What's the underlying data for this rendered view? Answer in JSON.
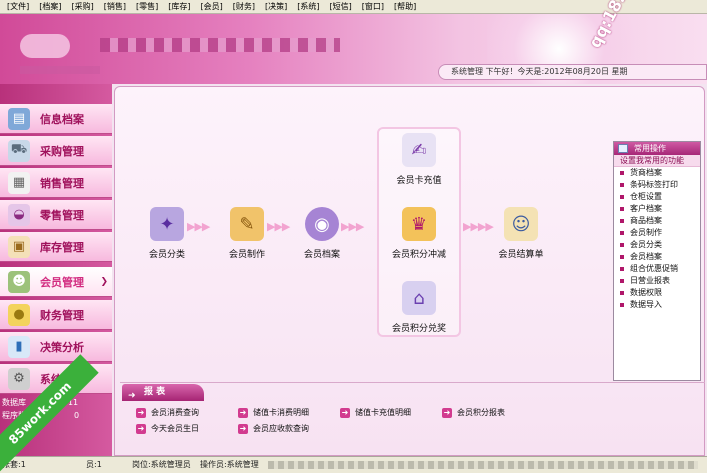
{
  "menu": [
    "[文件]",
    "[档案]",
    "[采购]",
    "[销售]",
    "[零售]",
    "[库存]",
    "[会员]",
    "[财务]",
    "[决策]",
    "[系统]",
    "[短信]",
    "[窗口]",
    "[帮助]"
  ],
  "header": {
    "status_text": "系统管理  下午好！今天是:2012年08月20日  星期"
  },
  "sidebar": {
    "items": [
      {
        "label": "信息档案",
        "icon": "id-card-icon"
      },
      {
        "label": "采购管理",
        "icon": "cart-icon"
      },
      {
        "label": "销售管理",
        "icon": "document-icon"
      },
      {
        "label": "零售管理",
        "icon": "basket-icon"
      },
      {
        "label": "库存管理",
        "icon": "clipboard-icon"
      },
      {
        "label": "会员管理",
        "icon": "users-icon"
      },
      {
        "label": "财务管理",
        "icon": "coins-icon"
      },
      {
        "label": "决策分析",
        "icon": "bar-chart-icon"
      },
      {
        "label": "系统功能",
        "icon": "gear-icon"
      }
    ],
    "active_index": 5,
    "info_line1": "数据库",
    "info_date": "-06-11",
    "info_line2": "程序版本",
    "info_version": "0"
  },
  "flow": {
    "items": [
      {
        "label": "会员分类"
      },
      {
        "label": "会员制作"
      },
      {
        "label": "会员档案"
      },
      {
        "label": "会员卡充值"
      },
      {
        "label": "会员积分冲减"
      },
      {
        "label": "会员积分兑奖"
      },
      {
        "label": "会员结算单"
      }
    ]
  },
  "common_ops": {
    "title": "常用操作",
    "subtitle": "设置我常用的功能",
    "items": [
      "货商档案",
      "条码标签打印",
      "仓柜设置",
      "客户档案",
      "商品档案",
      "会员制作",
      "会员分类",
      "会员档案",
      "组合优惠促销",
      "日营业报表",
      "数据权限",
      "数据导入"
    ]
  },
  "reports": {
    "title": "报 表",
    "links": [
      "会员消费查询",
      "储值卡消费明细",
      "储值卡充值明细",
      "会员积分报表",
      "今天会员生日",
      "会员应收款查询"
    ]
  },
  "status": {
    "account": "帐套:1",
    "emp": "员:1",
    "post": "岗位:系统管理员",
    "operator": "操作员:系统管理"
  },
  "watermarks": {
    "qq": "qq:1826816020",
    "site": "85work.com"
  }
}
